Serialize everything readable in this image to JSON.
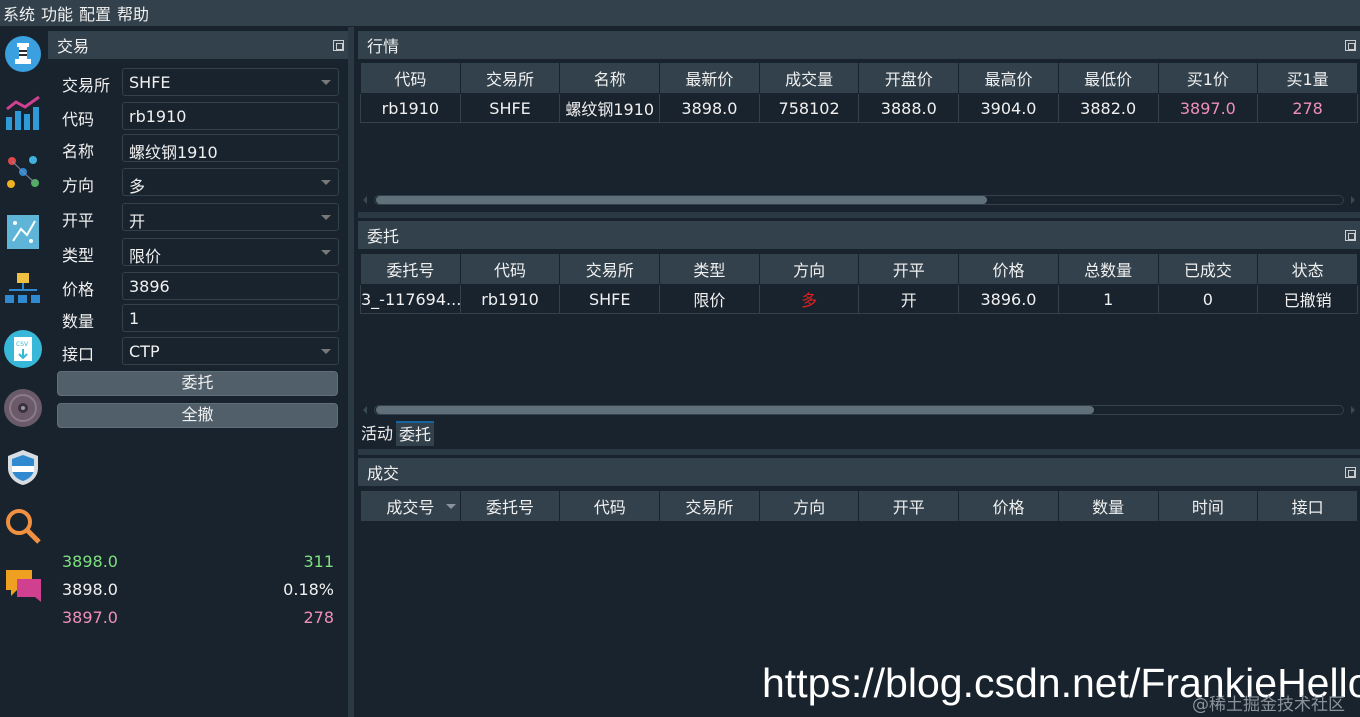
{
  "menu": [
    "系统",
    "功能",
    "配置",
    "帮助"
  ],
  "sidebar_icons": [
    "chess-rook-icon",
    "bar-chart-icon",
    "scatter-icon",
    "strategy-icon",
    "network-icon",
    "csv-icon",
    "record-disc-icon",
    "shield-icon",
    "search-icon",
    "chat-icon"
  ],
  "trade": {
    "title": "交易",
    "fields": [
      {
        "label": "交易所",
        "value": "SHFE",
        "kind": "combo"
      },
      {
        "label": "代码",
        "value": "rb1910",
        "kind": "input"
      },
      {
        "label": "名称",
        "value": "螺纹钢1910",
        "kind": "input"
      },
      {
        "label": "方向",
        "value": "多",
        "kind": "combo"
      },
      {
        "label": "开平",
        "value": "开",
        "kind": "combo"
      },
      {
        "label": "类型",
        "value": "限价",
        "kind": "combo"
      },
      {
        "label": "价格",
        "value": "3896",
        "kind": "input"
      },
      {
        "label": "数量",
        "value": "1",
        "kind": "input"
      },
      {
        "label": "接口",
        "value": "CTP",
        "kind": "combo"
      }
    ],
    "send_label": "委托",
    "cancel_all_label": "全撤",
    "quote_lines": [
      {
        "left": "3898.0",
        "right": "311",
        "color": "#7ee07e"
      },
      {
        "left": "3898.0",
        "right": "0.18%",
        "color": "#f0f0f0"
      },
      {
        "left": "3897.0",
        "right": "278",
        "color": "#f08fb8"
      }
    ]
  },
  "market": {
    "title": "行情",
    "columns": [
      "代码",
      "交易所",
      "名称",
      "最新价",
      "成交量",
      "开盘价",
      "最高价",
      "最低价",
      "买1价",
      "买1量"
    ],
    "rows": [
      [
        "rb1910",
        "SHFE",
        "螺纹钢1910",
        "3898.0",
        "758102",
        "3888.0",
        "3904.0",
        "3882.0",
        "3897.0",
        "278"
      ]
    ],
    "bid_color": "#f08fb8",
    "scroll_fraction": 0.63
  },
  "orders": {
    "title": "委托",
    "columns": [
      "委托号",
      "代码",
      "交易所",
      "类型",
      "方向",
      "开平",
      "价格",
      "总数量",
      "已成交",
      "状态"
    ],
    "rows": [
      [
        "3_-117694...",
        "rb1910",
        "SHFE",
        "限价",
        "多",
        "开",
        "3896.0",
        "1",
        "0",
        "已撤销"
      ]
    ],
    "direction_color": "#e02020",
    "scroll_fraction": 0.74
  },
  "tabs": [
    "活动",
    "委托"
  ],
  "trades": {
    "title": "成交",
    "columns": [
      "成交号",
      "委托号",
      "代码",
      "交易所",
      "方向",
      "开平",
      "价格",
      "数量",
      "时间",
      "接口"
    ]
  },
  "watermark": "https://blog.csdn.net/FrankieHello",
  "watermark_small": "@稀土掘金技术社区"
}
